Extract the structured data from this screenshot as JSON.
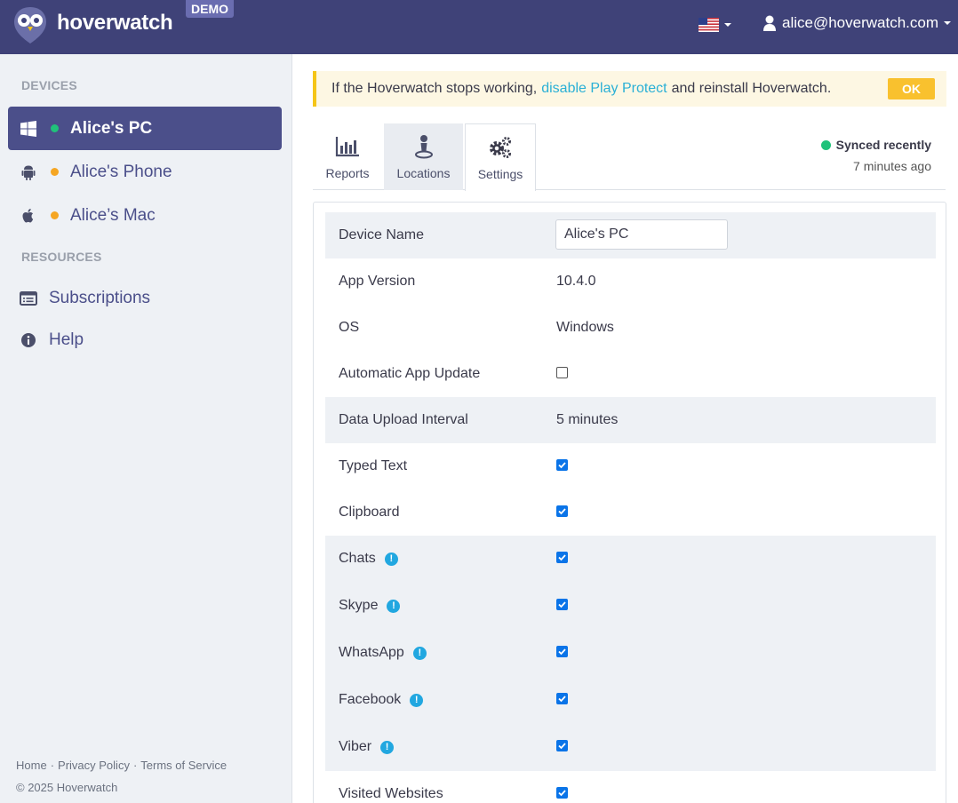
{
  "header": {
    "brand": "hoverwatch",
    "demo_badge": "DEMO",
    "user_email": "alice@hoverwatch.com",
    "language_flag": "us-flag-icon"
  },
  "sidebar": {
    "devices_label": "DEVICES",
    "devices": [
      {
        "label": "Alice's PC",
        "os_icon": "windows-icon",
        "status_color": "#20c27a",
        "active": true
      },
      {
        "label": "Alice's Phone",
        "os_icon": "android-icon",
        "status_color": "#f5a623",
        "active": false
      },
      {
        "label": "Alice’s Mac",
        "os_icon": "apple-icon",
        "status_color": "#f5a623",
        "active": false
      }
    ],
    "resources_label": "RESOURCES",
    "resources": [
      {
        "label": "Subscriptions",
        "icon": "subscriptions-icon"
      },
      {
        "label": "Help",
        "icon": "info-icon"
      }
    ],
    "footer": {
      "links": [
        "Home",
        "Privacy Policy",
        "Terms of Service"
      ],
      "copyright": "© 2025 Hoverwatch"
    }
  },
  "alert": {
    "text_before": "If the Hoverwatch stops working,",
    "link": "disable Play Protect",
    "text_after": "and reinstall Hoverwatch.",
    "ok_label": "OK"
  },
  "tabs": [
    {
      "label": "Reports",
      "icon": "bar-chart-icon"
    },
    {
      "label": "Locations",
      "icon": "location-pin-icon"
    },
    {
      "label": "Settings",
      "icon": "gears-icon"
    }
  ],
  "sync": {
    "status": "Synced recently",
    "time": "7 minutes ago"
  },
  "settings": {
    "device_name_label": "Device Name",
    "device_name_value": "Alice's PC",
    "app_version_label": "App Version",
    "app_version_value": "10.4.0",
    "os_label": "OS",
    "os_value": "Windows",
    "auto_update_label": "Automatic App Update",
    "upload_interval_label": "Data Upload Interval",
    "upload_interval_value": "5 minutes",
    "typed_text_label": "Typed Text",
    "clipboard_label": "Clipboard",
    "chats_label": "Chats",
    "skype_label": "Skype",
    "whatsapp_label": "WhatsApp",
    "facebook_label": "Facebook",
    "viber_label": "Viber",
    "visited_websites_label": "Visited Websites",
    "info_glyph": "!"
  },
  "colors": {
    "header_bg": "#3f4278",
    "accent": "#4b4f8a",
    "link": "#2bb0d6",
    "alert_border": "#f5c518",
    "ok_button": "#f9c12e",
    "checkbox": "#0a74e8",
    "online": "#20c27a",
    "away": "#f5a623"
  }
}
